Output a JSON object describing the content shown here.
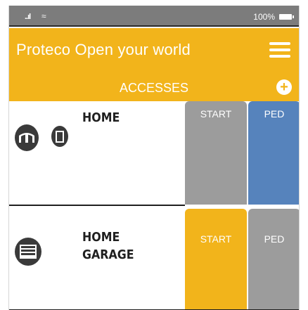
{
  "status_bar": {
    "signal": "..ıl",
    "wifi": "≈",
    "battery_percent": "100%"
  },
  "header": {
    "title": "Proteco Open your world",
    "section_title": "ACCESSES",
    "add_label": "+"
  },
  "accesses": [
    {
      "name": "HOME",
      "start_label": "START",
      "ped_label": "PED"
    },
    {
      "name": "HOME\nGARAGE",
      "start_label": "START",
      "ped_label": "PED"
    }
  ],
  "colors": {
    "status_bar": "#7c7c7c",
    "header": "#f2b41b",
    "start_gray": "#9c9c9c",
    "ped_blue": "#5683bc",
    "start_yellow": "#f2b41b",
    "ped_gray": "#9c9c9c",
    "icon": "#3a3a3a"
  }
}
